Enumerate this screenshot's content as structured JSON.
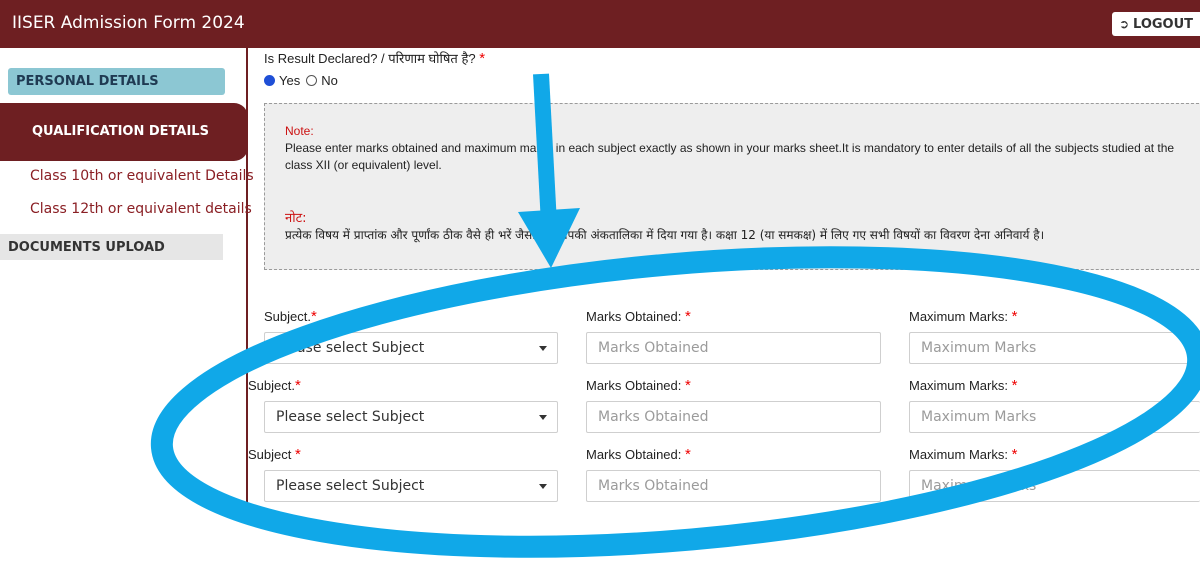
{
  "header": {
    "title": "IISER Admission Form 2024",
    "logout_label": "LOGOUT",
    "logout_icon": "logout-icon",
    "bg_color": "#6e1f22"
  },
  "sidebar": {
    "personal": "PERSONAL DETAILS",
    "qualification": "QUALIFICATION DETAILS",
    "class10": "Class 10th or equivalent Details",
    "class12": "Class 12th or equivalent details",
    "documents": "DOCUMENTS UPLOAD"
  },
  "result": {
    "question": "Is Result Declared? / परिणाम घोषित है?",
    "required_mark": "*",
    "yes_label": "Yes",
    "no_label": "No",
    "selected": "Yes"
  },
  "note": {
    "title_en": "Note:",
    "text_en": "Please enter marks obtained and maximum marks in each subject exactly as shown in your marks sheet.It is mandatory to enter details of all the subjects studied at the class XII (or equivalent) level.",
    "title_hi": "नोट:",
    "text_hi": "प्रत्येक विषय में प्राप्तांक और पूर्णांक ठीक वैसे ही भरें जैसा कि आपकी अंकतालिका में दिया गया है। कक्षा 12 (या समकक्ष) में लिए गए सभी विषयों का विवरण देना अनिवार्य है।"
  },
  "rows": [
    {
      "subject_label": "Subject.",
      "subject_value": "Please select Subject",
      "marks_label": "Marks Obtained:",
      "marks_placeholder": "Marks Obtained",
      "max_label": "Maximum Marks:",
      "max_placeholder": "Maximum Marks"
    },
    {
      "subject_label": "Subject.",
      "subject_value": "Please select Subject",
      "marks_label": "Marks Obtained:",
      "marks_placeholder": "Marks Obtained",
      "max_label": "Maximum Marks:",
      "max_placeholder": "Maximum Marks"
    },
    {
      "subject_label": "Subject",
      "subject_value": "Please select Subject",
      "marks_label": "Marks Obtained:",
      "marks_placeholder": "Marks Obtained",
      "max_label": "Maximum Marks:",
      "max_placeholder": "Maximum Marks"
    }
  ],
  "annotation": {
    "arrow": "down-arrow-annotation",
    "ellipse": "highlight-ellipse-annotation",
    "color": "#10a8e8"
  }
}
